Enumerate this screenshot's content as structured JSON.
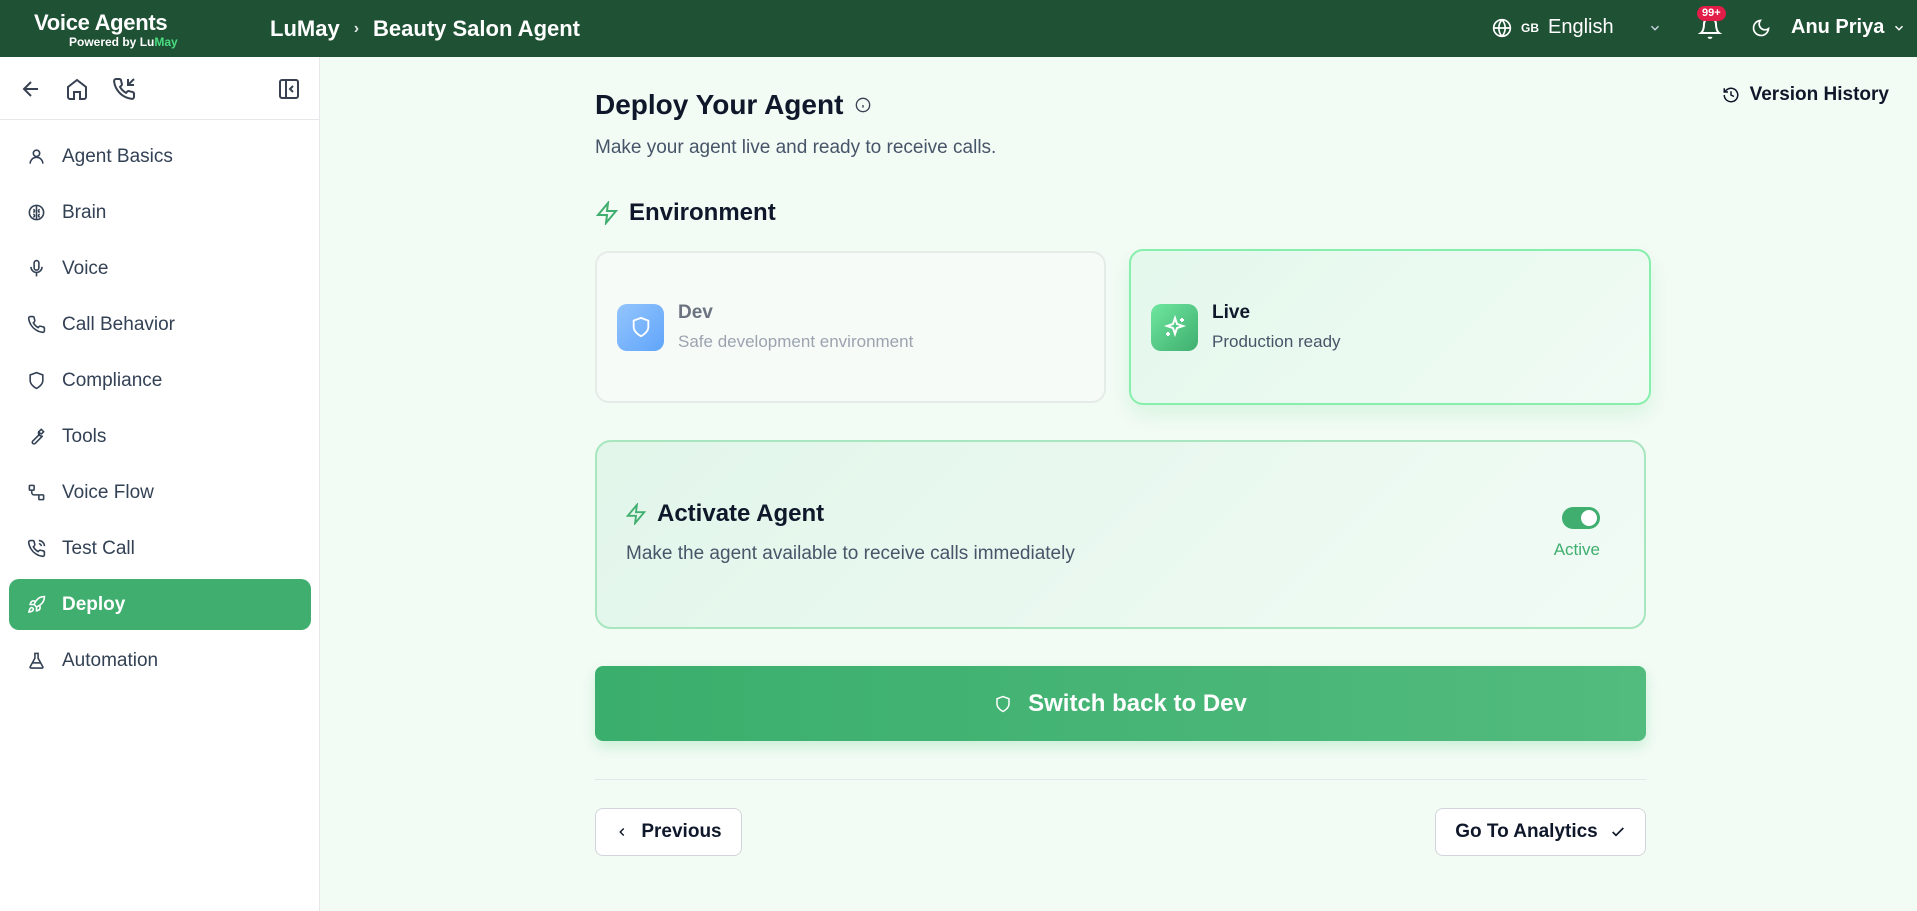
{
  "app": {
    "logo_title_a": "Voice ",
    "logo_title_b": "Agents",
    "logo_sub_a": "Powered by ",
    "logo_sub_b": "Lu",
    "logo_sub_c": "May"
  },
  "breadcrumb": {
    "org": "LuMay",
    "separator": "›",
    "agent": "Beauty Salon Agent"
  },
  "header": {
    "language_code": "GB",
    "language": "English",
    "notifications_badge": "99+",
    "user_name": "Anu Priya"
  },
  "sidebar": {
    "items": [
      {
        "label": "Agent Basics",
        "icon": "user-icon"
      },
      {
        "label": "Brain",
        "icon": "brain-icon"
      },
      {
        "label": "Voice",
        "icon": "microphone-icon"
      },
      {
        "label": "Call Behavior",
        "icon": "phone-icon"
      },
      {
        "label": "Compliance",
        "icon": "shield-icon"
      },
      {
        "label": "Tools",
        "icon": "wrench-icon"
      },
      {
        "label": "Voice Flow",
        "icon": "flow-icon"
      },
      {
        "label": "Test Call",
        "icon": "phone-call-icon"
      },
      {
        "label": "Deploy",
        "icon": "rocket-icon",
        "active": true
      },
      {
        "label": "Automation",
        "icon": "flask-icon"
      }
    ]
  },
  "main": {
    "title": "Deploy Your Agent",
    "subtitle": "Make your agent live and ready to receive calls.",
    "version_history": "Version History",
    "environment_title": "Environment",
    "env_dev": {
      "name": "Dev",
      "desc": "Safe development environment"
    },
    "env_live": {
      "name": "Live",
      "desc": "Production ready",
      "selected": true
    },
    "activate": {
      "title": "Activate Agent",
      "desc": "Make the agent available to receive calls immediately",
      "status": "Active",
      "enabled": true
    },
    "switch_button": "Switch back to Dev",
    "previous_button": "Previous",
    "next_button": "Go To Analytics"
  },
  "colors": {
    "header_bg": "#1f5135",
    "accent": "#3fae6e",
    "page_bg": "#f3fbf5",
    "brand_green": "#4ade80"
  }
}
